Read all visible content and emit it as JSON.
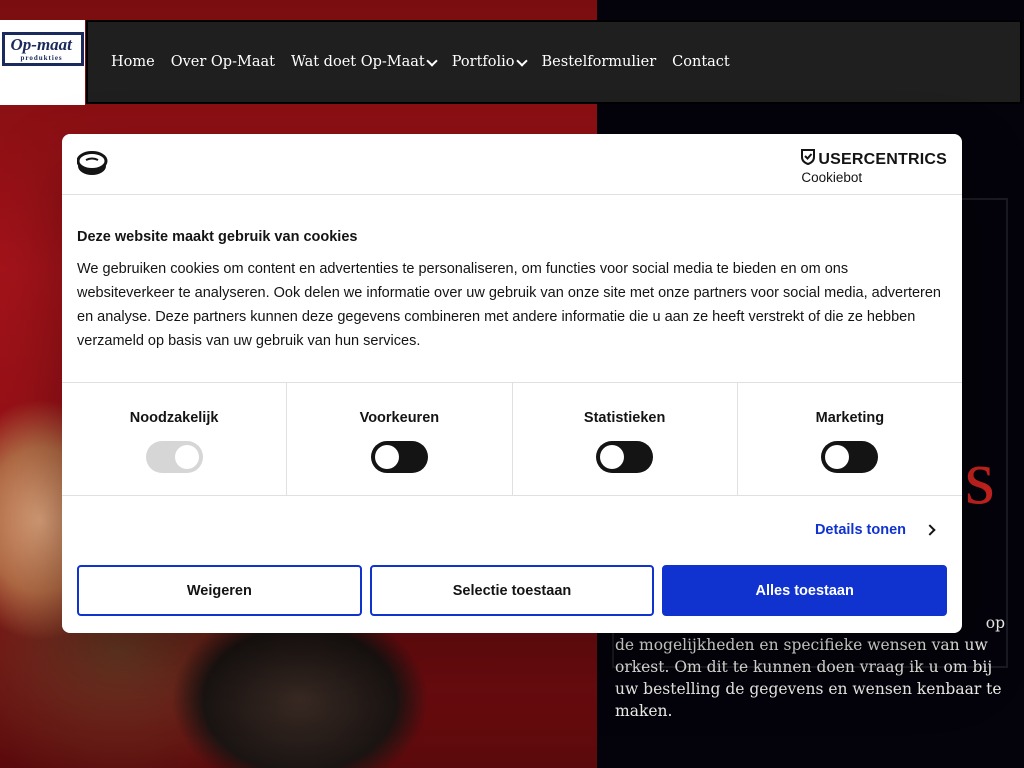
{
  "site": {
    "logo_text": "Op-maat",
    "logo_sub": "produkties",
    "nav": [
      {
        "label": "Home"
      },
      {
        "label": "Over Op-Maat"
      },
      {
        "label": "Wat doet Op-Maat"
      },
      {
        "label": "Portfolio"
      },
      {
        "label": "Bestelformulier"
      },
      {
        "label": "Contact"
      }
    ],
    "hero_heading_fragment": "es",
    "hero_text": "de mogelijkheden en specifieke wensen van uw orkest. Om dit te kunnen doen vraag ik u om bij uw bestelling de gegevens en wensen kenbaar te maken.",
    "hero_text_fragment": "op"
  },
  "cookie_dialog": {
    "brand_name": "USERCENTRICS",
    "brand_sub": "Cookiebot",
    "title": "Deze website maakt gebruik van cookies",
    "text": "We gebruiken cookies om content en advertenties te personaliseren, om functies voor social media te bieden en om ons websiteverkeer te analyseren. Ook delen we informatie over uw gebruik van onze site met onze partners voor social media, adverteren en analyse. Deze partners kunnen deze gegevens combineren met andere informatie die u aan ze heeft verstrekt of die ze hebben verzameld op basis van uw gebruik van hun services.",
    "categories": [
      {
        "label": "Noodzakelijk",
        "enabled": true,
        "disabled": true
      },
      {
        "label": "Voorkeuren",
        "enabled": false
      },
      {
        "label": "Statistieken",
        "enabled": false
      },
      {
        "label": "Marketing",
        "enabled": false
      }
    ],
    "details_label": "Details tonen",
    "buttons": {
      "reject": "Weigeren",
      "allow_selection": "Selectie toestaan",
      "allow_all": "Alles toestaan"
    },
    "colors": {
      "accent": "#1032cf",
      "text": "#141414"
    }
  }
}
